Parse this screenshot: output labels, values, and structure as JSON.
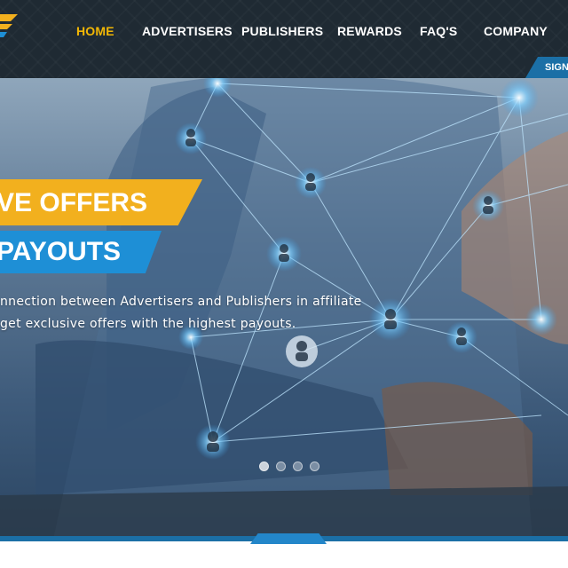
{
  "nav": {
    "items": [
      {
        "label": "HOME",
        "active": true
      },
      {
        "label": "ADVERTISERS",
        "active": false
      },
      {
        "label": "PUBLISHERS",
        "active": false
      },
      {
        "label": "REWARDS",
        "active": false
      },
      {
        "label": "FAQ'S",
        "active": false
      },
      {
        "label": "COMPANY",
        "active": false
      }
    ],
    "signup_label": "SIGN",
    "logo_icon": "logo-chevron-icon"
  },
  "hero": {
    "banner_line1": "VE OFFERS",
    "banner_line2": "PAYOUTS",
    "text_line1": "nnection between Advertisers and Publishers in affiliate",
    "text_line2": "get exclusive offers with the highest payouts.",
    "slides": 4,
    "active_slide": 1
  },
  "colors": {
    "nav_bg": "#1f2a33",
    "accent_yellow": "#f2b01e",
    "accent_blue": "#1e8fd6",
    "active_nav": "#f2b705"
  }
}
